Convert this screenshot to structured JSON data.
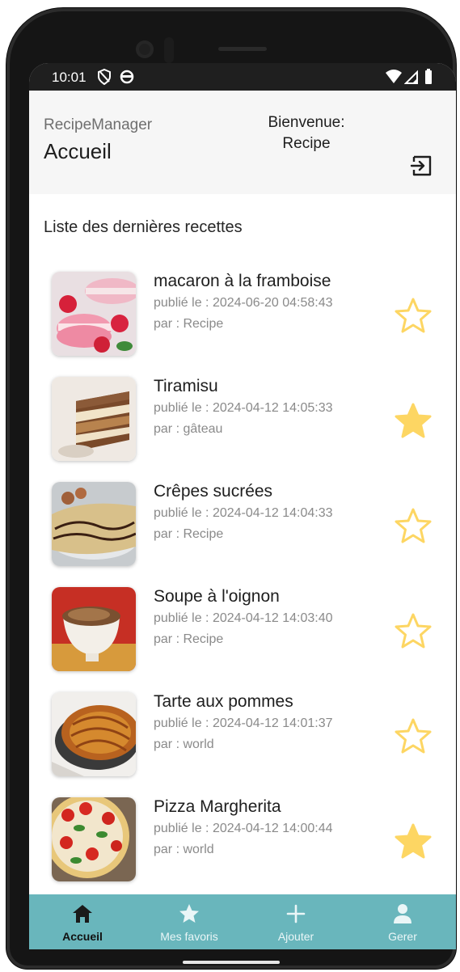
{
  "status_bar": {
    "time": "10:01",
    "left_icons": [
      "shield-icon",
      "circle-icon"
    ],
    "right_icons": [
      "wifi-icon",
      "signal-icon",
      "battery-icon"
    ]
  },
  "header": {
    "app_name": "RecipeManager",
    "page_title": "Accueil",
    "welcome_line1": "Bienvenue:",
    "welcome_line2": "Recipe",
    "logout_icon": "logout-icon"
  },
  "section_title": "Liste des dernières recettes",
  "recipes": [
    {
      "name": "macaron à la framboise",
      "published": "publié le : 2024-06-20 04:58:43",
      "author": "par : Recipe",
      "favorite": false
    },
    {
      "name": "Tiramisu",
      "published": "publié le : 2024-04-12 14:05:33",
      "author": "par : gâteau",
      "favorite": true
    },
    {
      "name": "Crêpes sucrées",
      "published": "publié le : 2024-04-12 14:04:33",
      "author": "par : Recipe",
      "favorite": false
    },
    {
      "name": "Soupe à l'oignon",
      "published": "publié le : 2024-04-12 14:03:40",
      "author": "par : Recipe",
      "favorite": false
    },
    {
      "name": "Tarte aux pommes",
      "published": "publié le : 2024-04-12 14:01:37",
      "author": "par : world",
      "favorite": false
    },
    {
      "name": "Pizza Margherita",
      "published": "publié le : 2024-04-12 14:00:44",
      "author": "par : world",
      "favorite": true
    }
  ],
  "tabs": [
    {
      "label": "Accueil",
      "icon": "home-icon",
      "active": true
    },
    {
      "label": "Mes favoris",
      "icon": "star-icon",
      "active": false
    },
    {
      "label": "Ajouter",
      "icon": "plus-icon",
      "active": false
    },
    {
      "label": "Gerer",
      "icon": "person-icon",
      "active": false
    }
  ],
  "colors": {
    "accent_tab_bar": "#69b6bc",
    "star": "#fdd663",
    "header_bg": "#f6f6f6"
  }
}
